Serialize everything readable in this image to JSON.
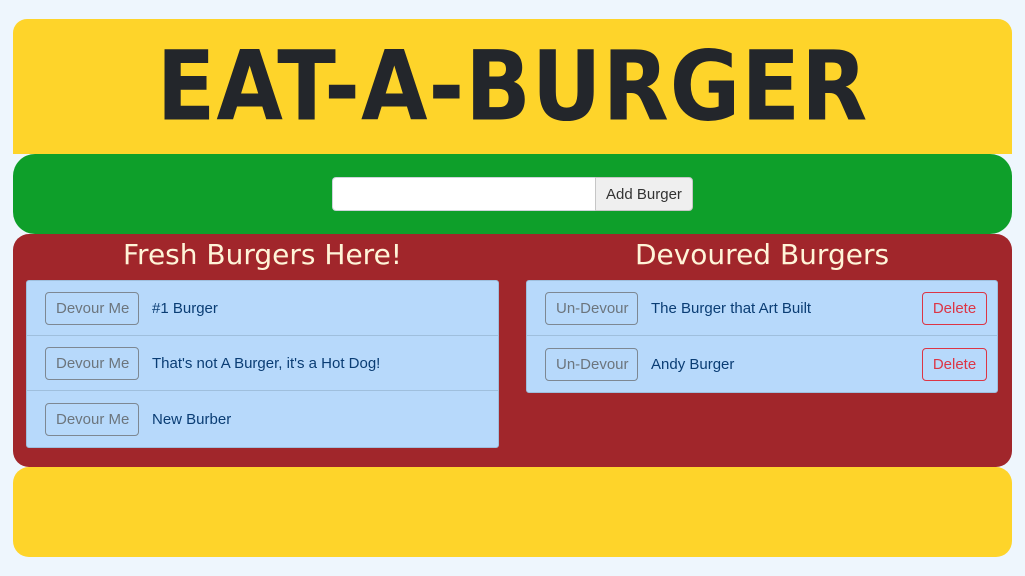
{
  "header": {
    "title": "EAT-A-BURGER"
  },
  "form": {
    "input_value": "",
    "input_placeholder": "",
    "add_label": "Add Burger"
  },
  "fresh": {
    "heading": "Fresh Burgers Here!",
    "button_label": "Devour Me",
    "items": [
      {
        "name": "#1 Burger"
      },
      {
        "name": "That's not A Burger, it's a Hot Dog!"
      },
      {
        "name": "New Burber"
      }
    ]
  },
  "devoured": {
    "heading": "Devoured Burgers",
    "button_label": "Un-Devour",
    "delete_label": "Delete",
    "items": [
      {
        "name": "The Burger that Art Built"
      },
      {
        "name": "Andy Burger"
      }
    ]
  },
  "colors": {
    "bun": "#fed42a",
    "lettuce": "#0e9f2a",
    "patty": "#a1262b",
    "list_bg": "#b7d9fb",
    "delete": "#dc3545",
    "page_bg": "#eef6fd"
  }
}
